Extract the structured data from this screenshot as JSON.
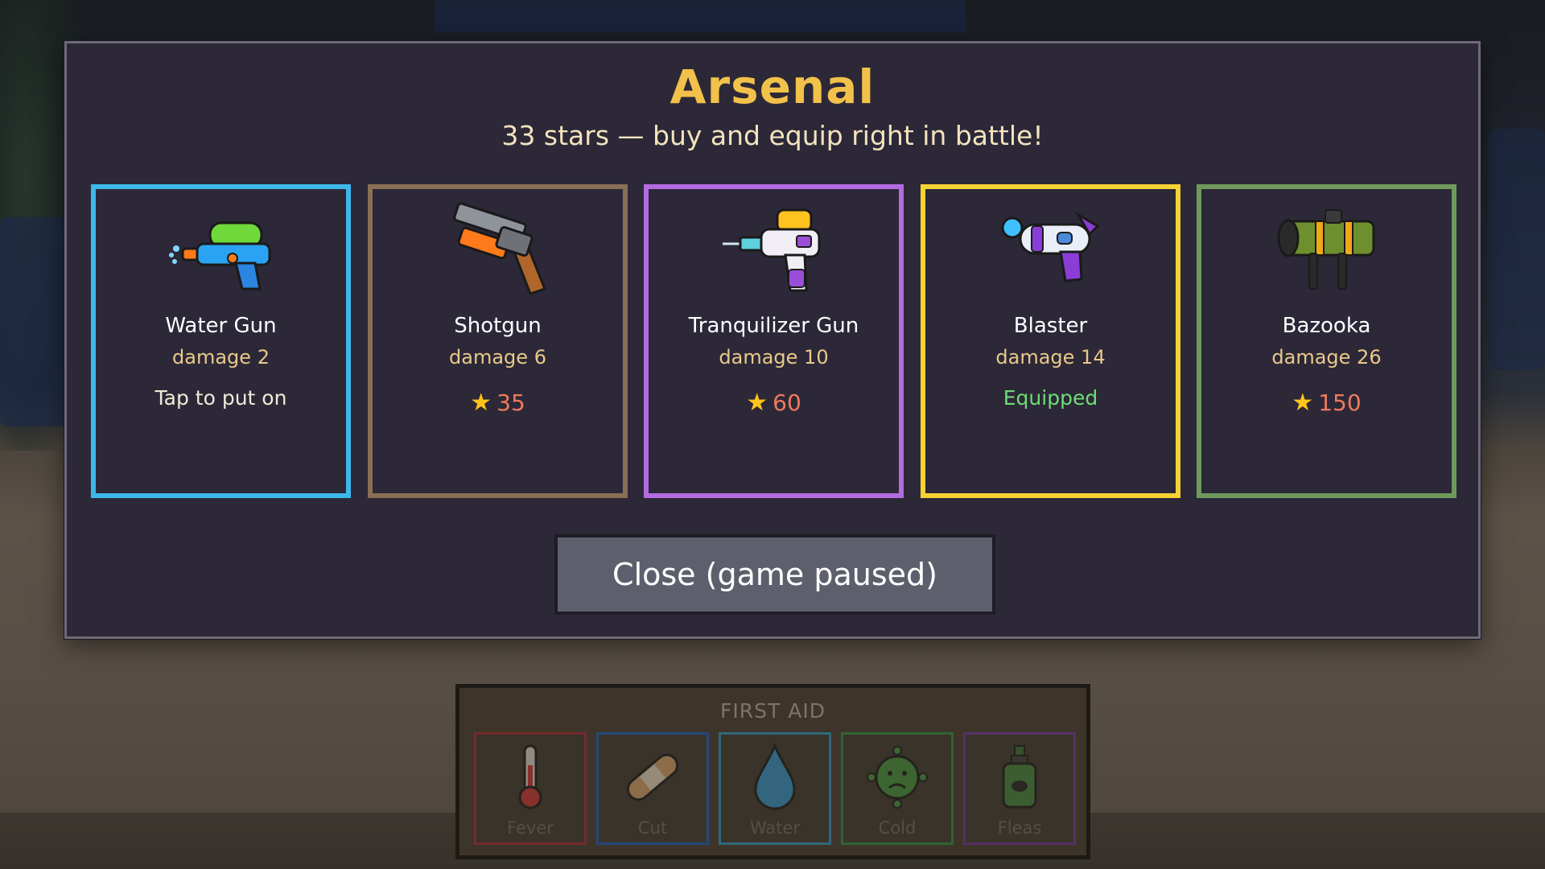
{
  "modal": {
    "title": "Arsenal",
    "subtitle": "33 stars — buy and equip right in battle!",
    "close_label": "Close (game paused)"
  },
  "weapons": [
    {
      "name": "Water Gun",
      "damage": "damage 2",
      "status": "Tap to put on",
      "price": null,
      "border_color": "#3cb8ea",
      "status_color": "#f1e9d8",
      "icon": "water-gun-icon"
    },
    {
      "name": "Shotgun",
      "damage": "damage 6",
      "status": null,
      "price": "35",
      "border_color": "#8a6e55",
      "icon": "shotgun-icon"
    },
    {
      "name": "Tranquilizer Gun",
      "damage": "damage 10",
      "status": null,
      "price": "60",
      "border_color": "#b36be0",
      "icon": "tranquilizer-gun-icon"
    },
    {
      "name": "Blaster",
      "damage": "damage 14",
      "status": "Equipped",
      "price": null,
      "border_color": "#f6d233",
      "status_color": "#6fdc76",
      "icon": "blaster-icon"
    },
    {
      "name": "Bazooka",
      "damage": "damage 26",
      "status": null,
      "price": "150",
      "border_color": "#6f9a5c",
      "icon": "bazooka-icon"
    }
  ],
  "first_aid": {
    "title": "FIRST AID",
    "items": [
      {
        "label": "Fever",
        "border_color": "#7a2a2a",
        "icon": "thermometer-icon"
      },
      {
        "label": "Cut",
        "border_color": "#234a84",
        "icon": "bandage-icon"
      },
      {
        "label": "Water",
        "border_color": "#2f6f85",
        "icon": "water-drop-icon"
      },
      {
        "label": "Cold",
        "border_color": "#2f6a34",
        "icon": "virus-icon"
      },
      {
        "label": "Fleas",
        "border_color": "#5b2f6f",
        "icon": "flea-spray-icon"
      }
    ]
  }
}
